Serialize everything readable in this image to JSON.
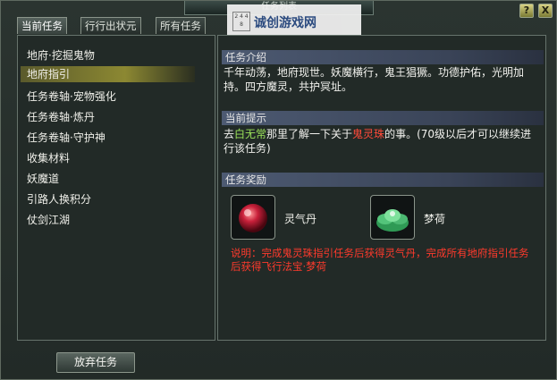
{
  "window": {
    "title": "任务列表"
  },
  "watermark": {
    "logo_text": "2 4 4 8",
    "text": "诚创游戏网"
  },
  "top_buttons": {
    "help": "?",
    "close": "X"
  },
  "tabs": [
    {
      "label": "当前任务",
      "active": true
    },
    {
      "label": "行行出状元",
      "active": false
    },
    {
      "label": "所有任务",
      "active": false
    }
  ],
  "task_list": [
    {
      "label": "地府·挖掘鬼物",
      "selected": false
    },
    {
      "label": "地府指引",
      "selected": true
    },
    {
      "label": "任务卷轴·宠物强化",
      "selected": false
    },
    {
      "label": "任务卷轴·炼丹",
      "selected": false
    },
    {
      "label": "任务卷轴·守护神",
      "selected": false
    },
    {
      "label": "收集材料",
      "selected": false
    },
    {
      "label": "妖魔道",
      "selected": false
    },
    {
      "label": "引路人换积分",
      "selected": false
    },
    {
      "label": "仗剑江湖",
      "selected": false
    }
  ],
  "intro": {
    "heading": "任务介绍",
    "text": "千年动荡，地府现世。妖魔横行，鬼王猖獗。功德护佑，光明加持。四方魔灵，共护冥址。"
  },
  "hint": {
    "heading": "当前提示",
    "t1": "去",
    "npc": "白无常",
    "t2": "那里了解一下关于",
    "item": "鬼灵珠",
    "t3": "的事。(70级以后才可以继续进行该任务)"
  },
  "rewards": {
    "heading": "任务奖励",
    "items": [
      {
        "name": "灵气丹",
        "icon": "red-orb-icon"
      },
      {
        "name": "梦荷",
        "icon": "green-lotus-icon"
      }
    ],
    "note": "说明：完成鬼灵珠指引任务后获得灵气丹，完成所有地府指引任务后获得飞行法宝·梦荷"
  },
  "footer": {
    "abandon_label": "放弃任务"
  },
  "colors": {
    "highlight_green": "#9be25a",
    "highlight_red": "#ff4a3a",
    "selection": "#8c8832"
  }
}
